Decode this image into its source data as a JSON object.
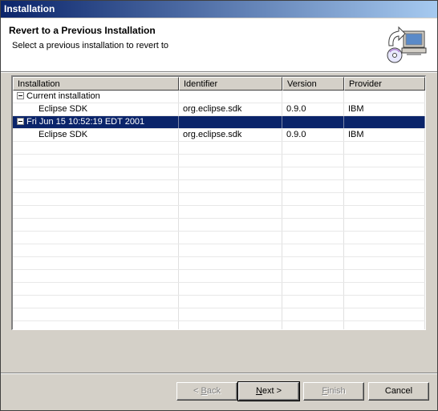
{
  "window": {
    "title": "Installation"
  },
  "header": {
    "title": "Revert to a Previous Installation",
    "description": "Select a previous installation to revert to",
    "icon": "revert-install-icon"
  },
  "table": {
    "columns": [
      "Installation",
      "Identifier",
      "Version",
      "Provider"
    ],
    "rows": [
      {
        "installation": "Current installation",
        "identifier": "",
        "version": "",
        "provider": ""
      },
      {
        "installation": "Eclipse SDK",
        "identifier": "org.eclipse.sdk",
        "version": "0.9.0",
        "provider": "IBM"
      },
      {
        "installation": "Fri Jun 15 10:52:19 EDT 2001",
        "identifier": "",
        "version": "",
        "provider": ""
      },
      {
        "installation": "Eclipse SDK",
        "identifier": "org.eclipse.sdk",
        "version": "0.9.0",
        "provider": "IBM"
      }
    ],
    "selected_row": 2
  },
  "buttons": {
    "back_prefix": "< ",
    "back_mnemonic": "B",
    "back_rest": "ack",
    "next_mnemonic": "N",
    "next_rest": "ext >",
    "finish_mnemonic": "F",
    "finish_rest": "inish",
    "cancel": "Cancel"
  },
  "colors": {
    "selection": "#0a246a",
    "titlebar": "#0a246a",
    "dialog_bg": "#d4d0c8"
  }
}
